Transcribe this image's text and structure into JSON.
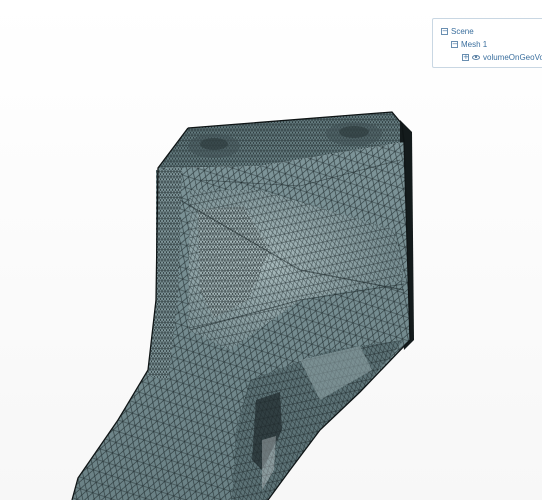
{
  "scene_tree": {
    "items": [
      {
        "label": "Scene",
        "toggle": "−"
      },
      {
        "label": "Mesh 1",
        "toggle": "−"
      },
      {
        "label": "volumeOnGeoVolume",
        "toggle": "+",
        "icon": "eye-icon"
      }
    ]
  },
  "viewport": {
    "mesh_fill": "#6c8387",
    "mesh_fill_light": "#8ea3a6",
    "mesh_fill_dark": "#4f6366",
    "edge_color": "#1b2628",
    "background": "#ffffff"
  }
}
